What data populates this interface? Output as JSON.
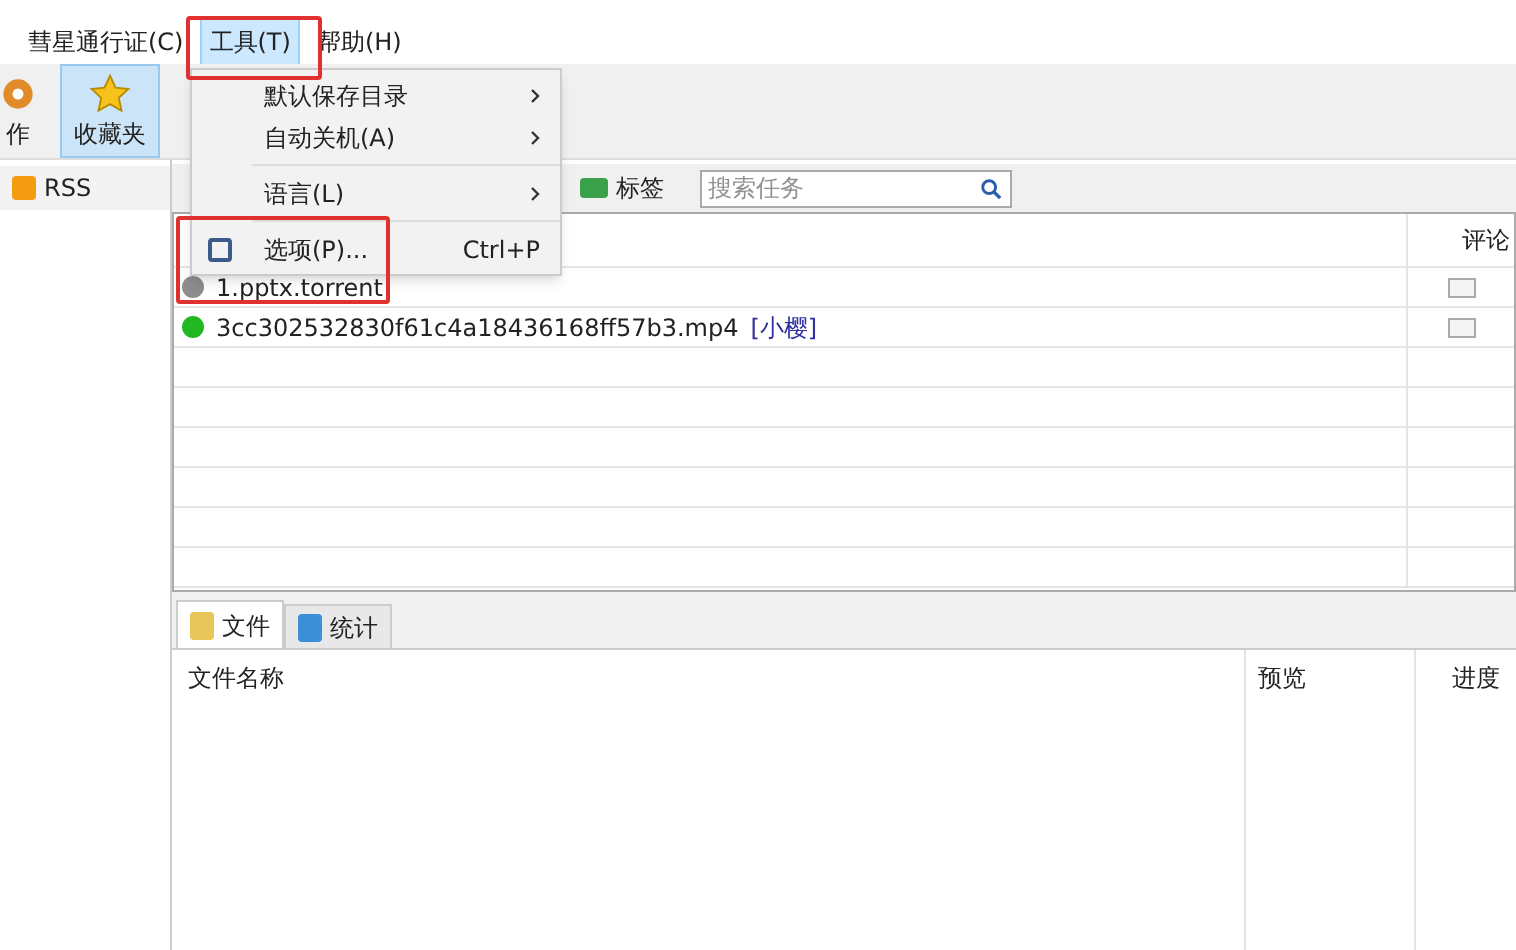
{
  "menu_bar": [
    {
      "label": "彗星通行证(C)",
      "selected": false
    },
    {
      "label": "工具(T)",
      "selected": true
    },
    {
      "label": "帮助(H)",
      "selected": false
    }
  ],
  "toolbar": [
    {
      "label": "作",
      "selected": false
    },
    {
      "label": "收藏夹",
      "selected": true
    }
  ],
  "sidebar": {
    "items": [
      {
        "label": "RSS"
      }
    ]
  },
  "task_toolbar": {
    "tag_button": "标签",
    "search": {
      "placeholder": "搜索任务"
    }
  },
  "task_table": {
    "columns": [
      "评论"
    ],
    "rows": [
      {
        "name": "1.pptx.torrent",
        "tag": "",
        "color": "#8c8c8c"
      },
      {
        "name": "3cc302532830f61c4a18436168ff57b3.mp4",
        "tag": "[小樱]",
        "color": "#22b822"
      }
    ]
  },
  "dropdown_menu": {
    "items": [
      {
        "label": "默认保存目录",
        "submenu": true
      },
      {
        "label": "自动关机(A)",
        "submenu": true
      },
      {
        "kind": "separator"
      },
      {
        "label": "语言(L)",
        "submenu": true
      },
      {
        "kind": "separator"
      },
      {
        "label": "选项(P)...",
        "submenu": false,
        "shortcut": "Ctrl+P",
        "icon": true
      }
    ]
  },
  "bottom_tabs": [
    {
      "label": "文件",
      "selected": true
    },
    {
      "label": "统计",
      "selected": false
    }
  ],
  "file_table": {
    "columns": [
      "文件名称",
      "预览",
      "进度"
    ]
  }
}
